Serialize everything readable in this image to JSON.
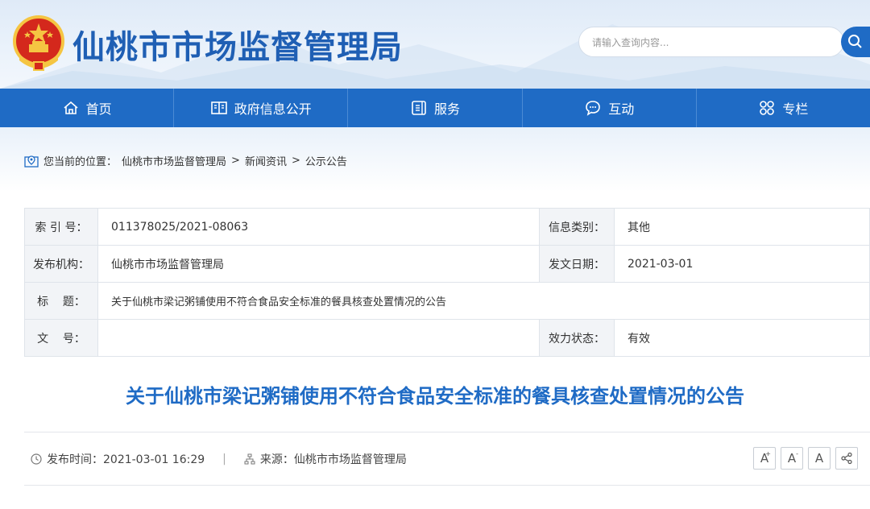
{
  "header": {
    "site_title": "仙桃市市场监督管理局",
    "search_placeholder": "请输入查询内容..."
  },
  "nav": {
    "items": [
      {
        "label": "首页",
        "icon": "home-icon"
      },
      {
        "label": "政府信息公开",
        "icon": "book-icon"
      },
      {
        "label": "服务",
        "icon": "document-icon"
      },
      {
        "label": "互动",
        "icon": "chat-icon"
      },
      {
        "label": "专栏",
        "icon": "grid-icon"
      }
    ]
  },
  "breadcrumb": {
    "prefix": "您当前的位置：",
    "items": [
      "仙桃市市场监督管理局",
      "新闻资讯",
      "公示公告"
    ],
    "separator": ">"
  },
  "info": {
    "index_label": "索 引 号：",
    "index_value": "011378025/2021-08063",
    "category_label": "信息类别：",
    "category_value": "其他",
    "publisher_label": "发布机构：",
    "publisher_value": "仙桃市市场监督管理局",
    "date_label": "发文日期：",
    "date_value": "2021-03-01",
    "title_label": "标    题：",
    "title_value": "关于仙桃市梁记粥铺使用不符合食品安全标准的餐具核查处置情况的公告",
    "docno_label": "文    号：",
    "docno_value": "",
    "status_label": "效力状态：",
    "status_value": "有效"
  },
  "article": {
    "title": "关于仙桃市梁记粥铺使用不符合食品安全标准的餐具核查处置情况的公告",
    "publish_time": "发布时间：2021-03-01 16:29",
    "source": "来源：仙桃市市场监督管理局",
    "separator": "|"
  },
  "tools": {
    "font_large": "A",
    "font_medium": "A",
    "font_small": "A",
    "plus": "+",
    "minus": "-"
  },
  "colors": {
    "brand_blue": "#1f6bc5",
    "title_blue": "#1f5fb4"
  }
}
